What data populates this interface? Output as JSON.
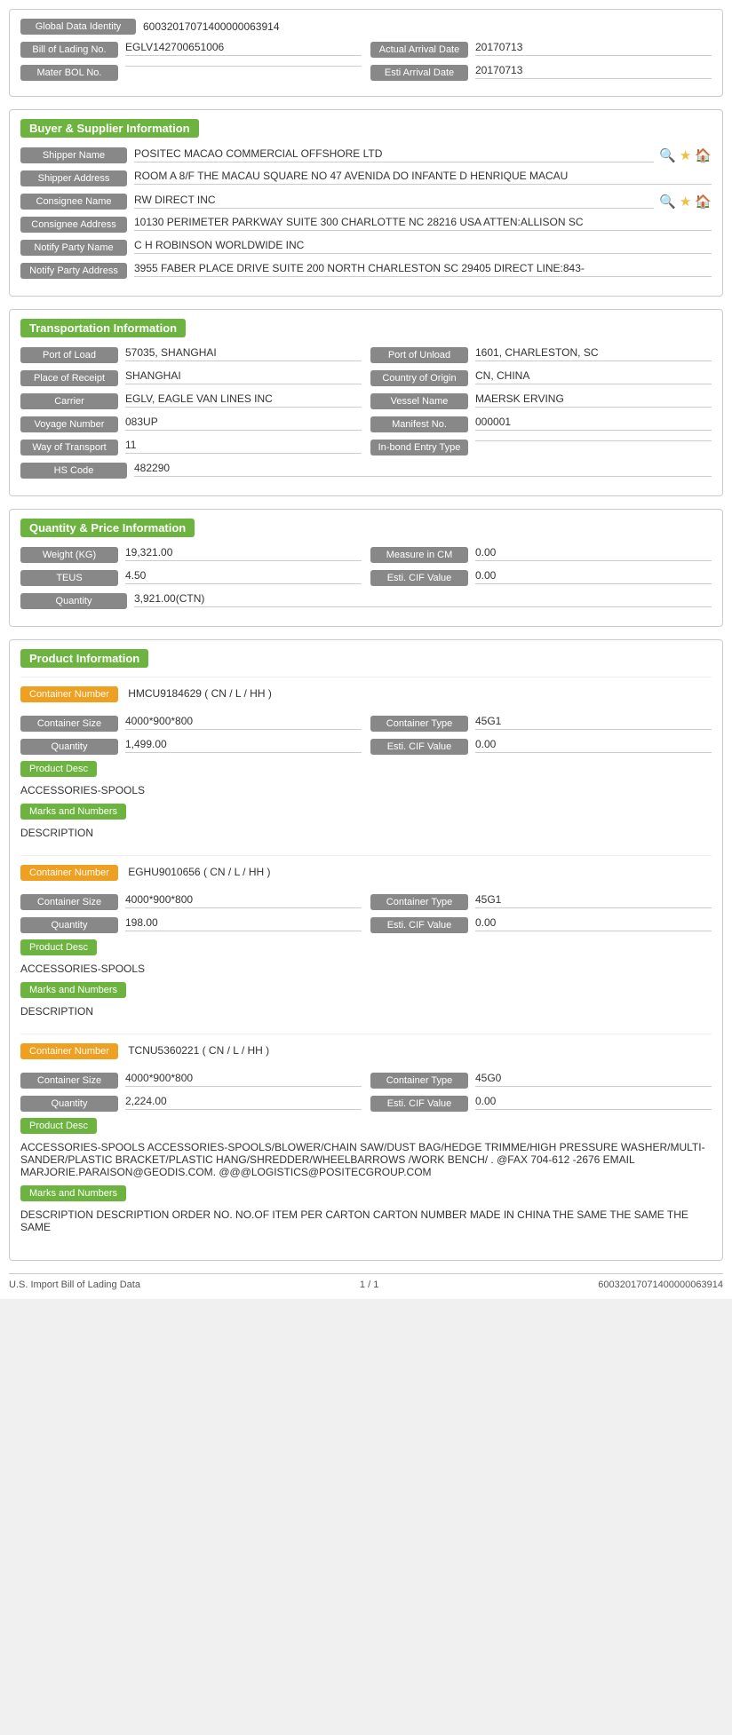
{
  "global": {
    "global_data_identity_label": "Global Data Identity",
    "global_data_identity_value": "60032017071400000063914",
    "bill_of_lading_label": "Bill of Lading No.",
    "bill_of_lading_value": "EGLV142700651006",
    "actual_arrival_date_label": "Actual Arrival Date",
    "actual_arrival_date_value": "20170713",
    "master_bol_label": "Mater BOL No.",
    "master_bol_value": "",
    "esti_arrival_date_label": "Esti Arrival Date",
    "esti_arrival_date_value": "20170713"
  },
  "buyer_supplier": {
    "header": "Buyer & Supplier Information",
    "shipper_name_label": "Shipper Name",
    "shipper_name_value": "POSITEC MACAO COMMERCIAL OFFSHORE LTD",
    "shipper_address_label": "Shipper Address",
    "shipper_address_value": "ROOM A 8/F THE MACAU SQUARE NO 47 AVENIDA DO INFANTE D HENRIQUE MACAU",
    "consignee_name_label": "Consignee Name",
    "consignee_name_value": "RW DIRECT INC",
    "consignee_address_label": "Consignee Address",
    "consignee_address_value": "10130 PERIMETER PARKWAY SUITE 300 CHARLOTTE NC 28216 USA ATTEN:ALLISON SC",
    "notify_party_name_label": "Notify Party Name",
    "notify_party_name_value": "C H ROBINSON WORLDWIDE INC",
    "notify_party_address_label": "Notify Party Address",
    "notify_party_address_value": "3955 FABER PLACE DRIVE SUITE 200 NORTH CHARLESTON SC 29405 DIRECT LINE:843-"
  },
  "transportation": {
    "header": "Transportation Information",
    "port_of_load_label": "Port of Load",
    "port_of_load_value": "57035, SHANGHAI",
    "port_of_unload_label": "Port of Unload",
    "port_of_unload_value": "1601, CHARLESTON, SC",
    "place_of_receipt_label": "Place of Receipt",
    "place_of_receipt_value": "SHANGHAI",
    "country_of_origin_label": "Country of Origin",
    "country_of_origin_value": "CN, CHINA",
    "carrier_label": "Carrier",
    "carrier_value": "EGLV, EAGLE VAN LINES INC",
    "vessel_name_label": "Vessel Name",
    "vessel_name_value": "MAERSK ERVING",
    "voyage_number_label": "Voyage Number",
    "voyage_number_value": "083UP",
    "manifest_no_label": "Manifest No.",
    "manifest_no_value": "000001",
    "way_of_transport_label": "Way of Transport",
    "way_of_transport_value": "11",
    "in_bond_entry_type_label": "In-bond Entry Type",
    "in_bond_entry_type_value": "",
    "hs_code_label": "HS Code",
    "hs_code_value": "482290"
  },
  "quantity_price": {
    "header": "Quantity & Price Information",
    "weight_kg_label": "Weight (KG)",
    "weight_kg_value": "19,321.00",
    "measure_in_cm_label": "Measure in CM",
    "measure_in_cm_value": "0.00",
    "teus_label": "TEUS",
    "teus_value": "4.50",
    "esti_cif_value_label": "Esti. CIF Value",
    "esti_cif_value_value": "0.00",
    "quantity_label": "Quantity",
    "quantity_value": "3,921.00(CTN)"
  },
  "product_information": {
    "header": "Product Information",
    "containers": [
      {
        "container_number_label": "Container Number",
        "container_number_value": "HMCU9184629 ( CN / L / HH )",
        "container_size_label": "Container Size",
        "container_size_value": "4000*900*800",
        "container_type_label": "Container Type",
        "container_type_value": "45G1",
        "quantity_label": "Quantity",
        "quantity_value": "1,499.00",
        "esti_cif_label": "Esti. CIF Value",
        "esti_cif_value": "0.00",
        "product_desc_label": "Product Desc",
        "product_desc_value": "ACCESSORIES-SPOOLS",
        "marks_numbers_label": "Marks and Numbers",
        "marks_numbers_value": "DESCRIPTION"
      },
      {
        "container_number_label": "Container Number",
        "container_number_value": "EGHU9010656 ( CN / L / HH )",
        "container_size_label": "Container Size",
        "container_size_value": "4000*900*800",
        "container_type_label": "Container Type",
        "container_type_value": "45G1",
        "quantity_label": "Quantity",
        "quantity_value": "198.00",
        "esti_cif_label": "Esti. CIF Value",
        "esti_cif_value": "0.00",
        "product_desc_label": "Product Desc",
        "product_desc_value": "ACCESSORIES-SPOOLS",
        "marks_numbers_label": "Marks and Numbers",
        "marks_numbers_value": "DESCRIPTION"
      },
      {
        "container_number_label": "Container Number",
        "container_number_value": "TCNU5360221 ( CN / L / HH )",
        "container_size_label": "Container Size",
        "container_size_value": "4000*900*800",
        "container_type_label": "Container Type",
        "container_type_value": "45G0",
        "quantity_label": "Quantity",
        "quantity_value": "2,224.00",
        "esti_cif_label": "Esti. CIF Value",
        "esti_cif_value": "0.00",
        "product_desc_label": "Product Desc",
        "product_desc_value": "ACCESSORIES-SPOOLS ACCESSORIES-SPOOLS/BLOWER/CHAIN SAW/DUST BAG/HEDGE TRIMME/HIGH PRESSURE WASHER/MULTI-SANDER/PLASTIC BRACKET/PLASTIC HANG/SHREDDER/WHEELBARROWS /WORK BENCH/ . @FAX 704-612 -2676 EMAIL MARJORIE.PARAISON@GEODIS.COM. @@@LOGISTICS@POSITECGROUP.COM",
        "marks_numbers_label": "Marks and Numbers",
        "marks_numbers_value": "DESCRIPTION DESCRIPTION ORDER NO. NO.OF ITEM PER CARTON CARTON NUMBER MADE IN CHINA THE SAME THE SAME THE SAME"
      }
    ]
  },
  "footer": {
    "left": "U.S. Import Bill of Lading Data",
    "center": "1 / 1",
    "right": "60032017071400000063914"
  }
}
